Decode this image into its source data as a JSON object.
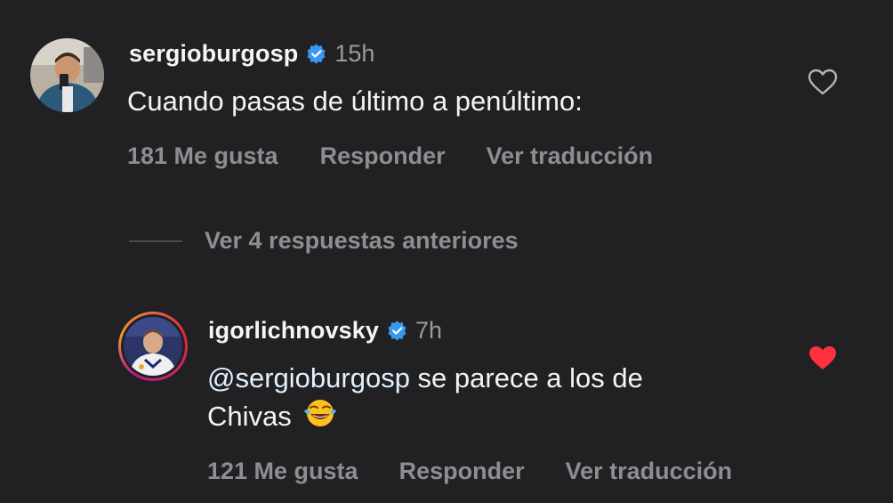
{
  "comments": [
    {
      "username": "sergioburgosp",
      "time": "15h",
      "text": "Cuando pasas de último a penúltimo:",
      "likes_label": "181 Me gusta",
      "reply_label": "Responder",
      "translate_label": "Ver traducción",
      "liked": false
    },
    {
      "username": "igorlichnovsky",
      "time": "7h",
      "mention": "@sergioburgosp",
      "text_after_mention": " se parece a los de",
      "text_line2": "Chivas",
      "emoji": "face-with-tears-of-joy",
      "likes_label": "121 Me gusta",
      "reply_label": "Responder",
      "translate_label": "Ver traducción",
      "liked": true
    }
  ],
  "view_replies_label": "Ver 4 respuestas anteriores",
  "colors": {
    "background": "#212123",
    "verified": "#3897f0",
    "heart_liked": "#ff3040",
    "muted": "#8e8e92"
  }
}
